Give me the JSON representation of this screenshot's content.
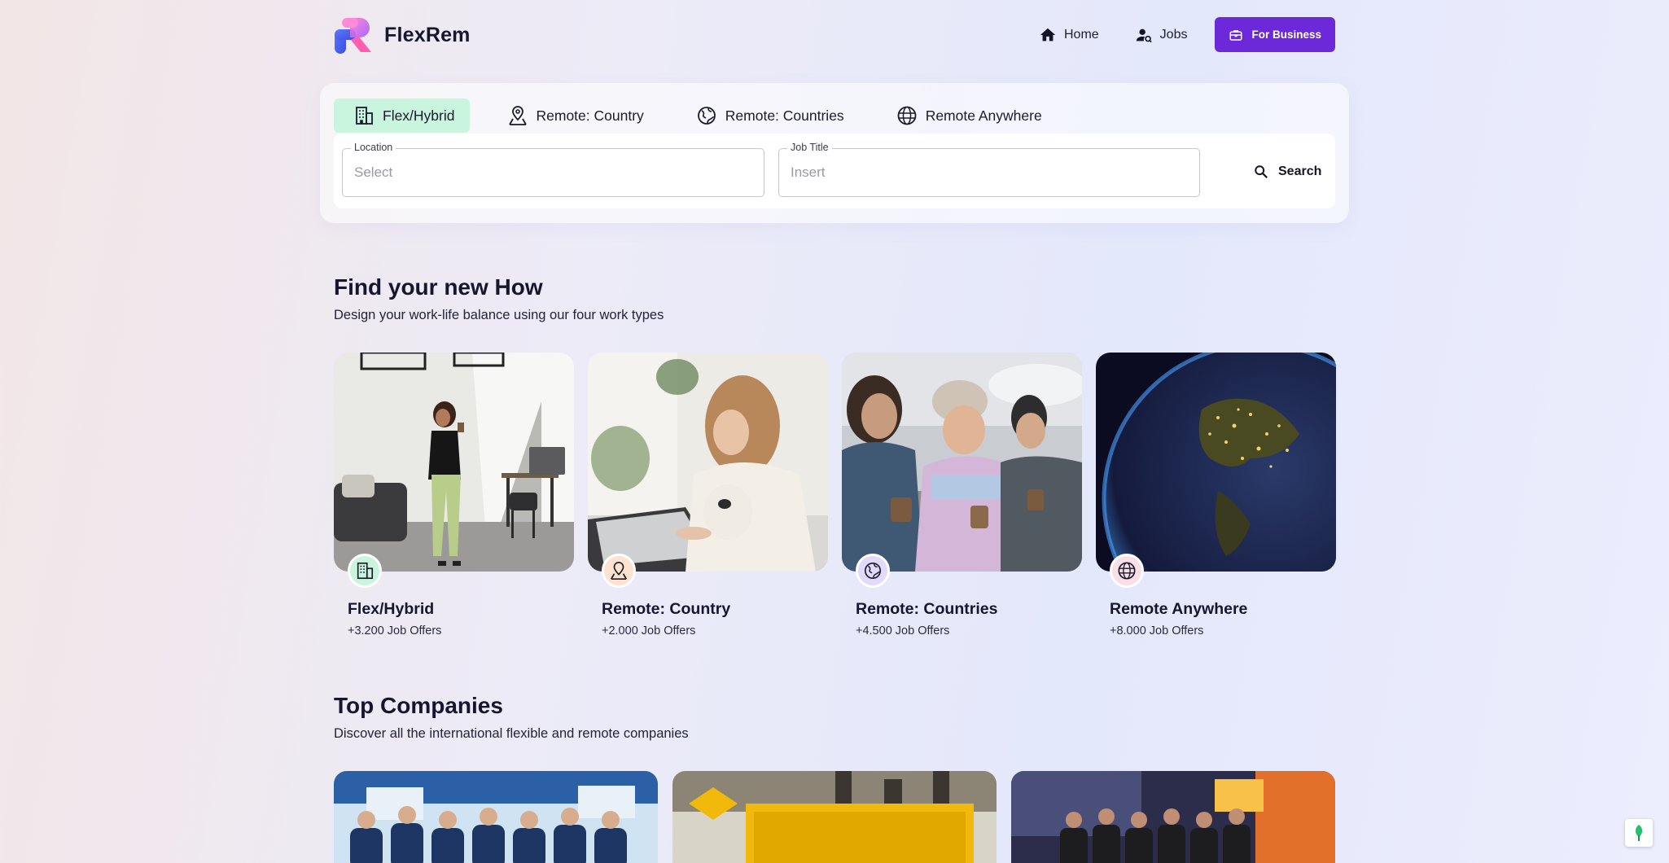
{
  "brand": {
    "name": "FlexRem"
  },
  "nav": {
    "home": "Home",
    "jobs": "Jobs",
    "business": "For Business"
  },
  "search": {
    "tabs": [
      {
        "label": "Flex/Hybrid"
      },
      {
        "label": "Remote: Country"
      },
      {
        "label": "Remote: Countries"
      },
      {
        "label": "Remote Anywhere"
      }
    ],
    "location": {
      "label": "Location",
      "placeholder": "Select"
    },
    "job_title": {
      "label": "Job Title",
      "placeholder": "Insert"
    },
    "button": "Search"
  },
  "work_types": {
    "title": "Find your new How",
    "subtitle": "Design your work-life balance using our four work types",
    "cards": [
      {
        "title": "Flex/Hybrid",
        "offers": "+3.200 Job Offers",
        "icon": "office-building-icon",
        "accent": "#c9f5de"
      },
      {
        "title": "Remote: Country",
        "offers": "+2.000 Job Offers",
        "icon": "map-pin-person-icon",
        "accent": "#fde3cf"
      },
      {
        "title": "Remote: Countries",
        "offers": "+4.500 Job Offers",
        "icon": "continents-icon",
        "accent": "#e3d9fb"
      },
      {
        "title": "Remote Anywhere",
        "offers": "+8.000 Job Offers",
        "icon": "globe-icon",
        "accent": "#fbdfe6"
      }
    ]
  },
  "companies": {
    "title": "Top Companies",
    "subtitle": "Discover all the international flexible and remote companies"
  }
}
